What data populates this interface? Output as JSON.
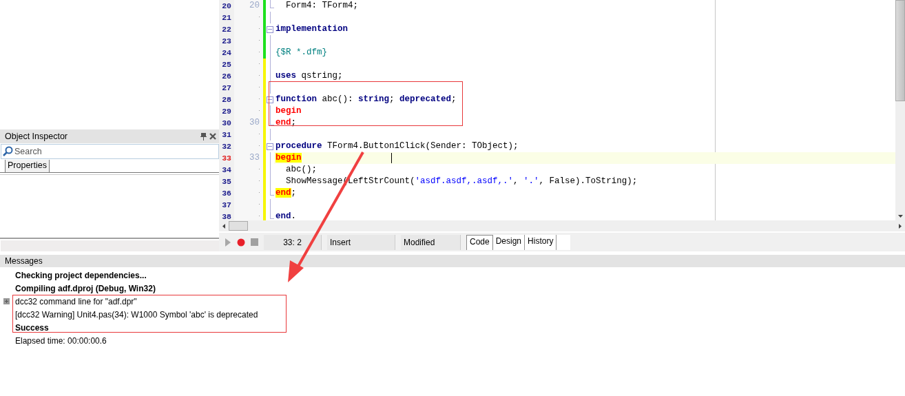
{
  "editor": {
    "lines": [
      {
        "number": "20",
        "mark": "20",
        "modified": false,
        "fold_start": false,
        "fold_end": true,
        "current": false,
        "code": [
          {
            "text": "  Form4: TForm4;",
            "kind": "plain"
          }
        ]
      },
      {
        "number": "21",
        "modified": false,
        "fold_start": false,
        "fold_end": false,
        "current": false
      },
      {
        "number": "22",
        "modified": false,
        "fold_start": true,
        "fold_end": false,
        "current": false,
        "code": [
          {
            "text": "implementation",
            "kind": "kw"
          }
        ]
      },
      {
        "number": "23",
        "modified": false,
        "fold_start": false,
        "fold_end": false,
        "current": false
      },
      {
        "number": "24",
        "modified": false,
        "fold_start": false,
        "fold_end": false,
        "current": false,
        "code": [
          {
            "text": "{$R *.dfm}",
            "kind": "directive"
          }
        ]
      },
      {
        "number": "25",
        "modified": true,
        "fold_start": false,
        "fold_end": false,
        "current": false
      },
      {
        "number": "26",
        "modified": true,
        "fold_start": false,
        "fold_end": false,
        "current": false,
        "code": [
          {
            "text": "uses",
            "kind": "kw"
          },
          {
            "text": " qstring;",
            "kind": "plain"
          }
        ]
      },
      {
        "number": "27",
        "modified": true,
        "fold_start": false,
        "fold_end": false,
        "current": false
      },
      {
        "number": "28",
        "modified": true,
        "fold_start": true,
        "fold_end": false,
        "current": false,
        "code": [
          {
            "text": "function",
            "kind": "kw"
          },
          {
            "text": " abc(): ",
            "kind": "plain"
          },
          {
            "text": "string",
            "kind": "kw"
          },
          {
            "text": "; ",
            "kind": "plain"
          },
          {
            "text": "deprecated",
            "kind": "kw"
          },
          {
            "text": ";",
            "kind": "plain"
          }
        ]
      },
      {
        "number": "29",
        "modified": true,
        "fold_start": false,
        "fold_end": false,
        "current": false,
        "code": [
          {
            "text": "begin",
            "kind": "block"
          }
        ]
      },
      {
        "number": "30",
        "mark": "30",
        "modified": true,
        "fold_start": false,
        "fold_end": true,
        "current": false,
        "code": [
          {
            "text": "end",
            "kind": "block"
          },
          {
            "text": ";",
            "kind": "plain"
          }
        ]
      },
      {
        "number": "31",
        "modified": true,
        "fold_start": false,
        "fold_end": false,
        "current": false
      },
      {
        "number": "32",
        "modified": true,
        "fold_start": true,
        "fold_end": false,
        "current": false,
        "code": [
          {
            "text": "procedure",
            "kind": "kw"
          },
          {
            "text": " TForm4.Button1Click(Sender: TObject);",
            "kind": "plain"
          }
        ]
      },
      {
        "number": "33",
        "mark": "33",
        "modified": true,
        "fold_start": false,
        "fold_end": false,
        "current": true,
        "code": [
          {
            "text": "begin",
            "kind": "match"
          }
        ]
      },
      {
        "number": "34",
        "modified": true,
        "fold_start": false,
        "fold_end": false,
        "current": false,
        "code": [
          {
            "text": "  abc();",
            "kind": "plain"
          }
        ]
      },
      {
        "number": "35",
        "modified": true,
        "fold_start": false,
        "fold_end": false,
        "current": false,
        "code": [
          {
            "text": "  ShowMessage(LeftStrCount(",
            "kind": "plain"
          },
          {
            "text": "'asdf.asdf,.asdf,.'",
            "kind": "str"
          },
          {
            "text": ", ",
            "kind": "plain"
          },
          {
            "text": "'.'",
            "kind": "str"
          },
          {
            "text": ", False).ToString);",
            "kind": "plain"
          }
        ]
      },
      {
        "number": "36",
        "modified": true,
        "fold_start": false,
        "fold_end": true,
        "current": false,
        "code": [
          {
            "text": "end",
            "kind": "match"
          },
          {
            "text": ";",
            "kind": "plain"
          }
        ]
      },
      {
        "number": "37",
        "modified": true,
        "fold_start": false,
        "fold_end": false,
        "current": false
      },
      {
        "number": "38",
        "modified": true,
        "fold_start": false,
        "fold_end": true,
        "current": false,
        "code": [
          {
            "text": "end",
            "kind": "kw"
          },
          {
            "text": ".",
            "kind": "plain"
          }
        ]
      }
    ],
    "status": {
      "position": "33: 2",
      "mode": "Insert",
      "state": "Modified"
    },
    "tabs": [
      {
        "label": "Code",
        "selected": true
      },
      {
        "label": "Design",
        "selected": false
      },
      {
        "label": "History",
        "selected": false
      }
    ]
  },
  "object_inspector": {
    "title": "Object Inspector",
    "search": {
      "placeholder": "Search"
    },
    "tabs": [
      {
        "label": "Properties",
        "selected": true
      }
    ]
  },
  "messages": {
    "title": "Messages",
    "items": [
      {
        "text": "Checking project dependencies...",
        "bold": true,
        "expandable": false
      },
      {
        "text": "Compiling adf.dproj (Debug, Win32)",
        "bold": true,
        "expandable": false
      },
      {
        "text": "dcc32 command line for \"adf.dpr\"",
        "bold": false,
        "expandable": true
      },
      {
        "text": "[dcc32 Warning] Unit4.pas(34): W1000 Symbol 'abc' is deprecated",
        "bold": false,
        "expandable": false
      },
      {
        "text": "Success",
        "bold": true,
        "expandable": false
      },
      {
        "text": "Elapsed time: 00:00:00.6",
        "bold": false,
        "expandable": false
      }
    ]
  }
}
